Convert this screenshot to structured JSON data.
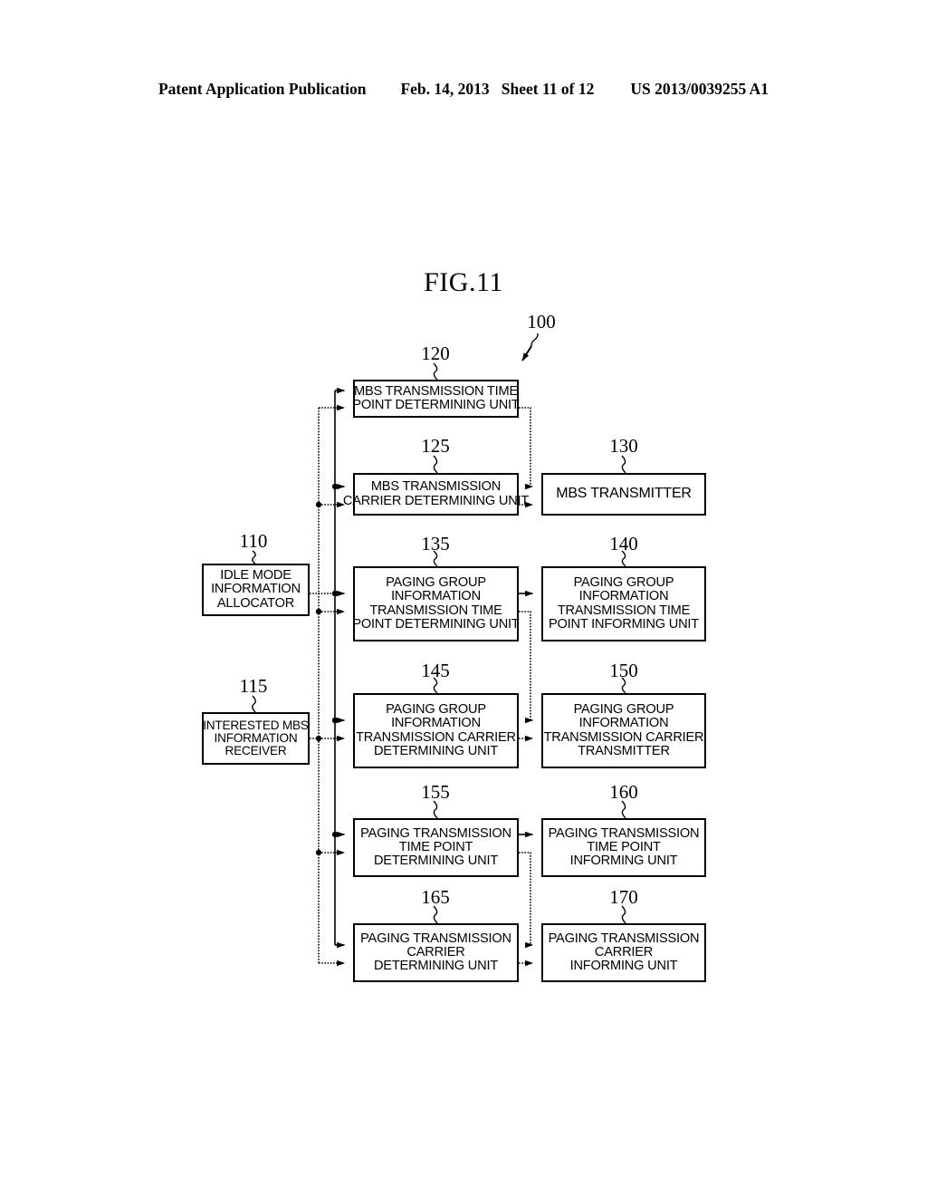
{
  "header": {
    "publication": "Patent Application Publication",
    "date": "Feb. 14, 2013",
    "sheet": "Sheet 11 of 12",
    "number": "US 2013/0039255 A1"
  },
  "figure": {
    "title": "FIG.11",
    "system_ref": "100"
  },
  "refs": {
    "r110": "110",
    "r115": "115",
    "r120": "120",
    "r125": "125",
    "r130": "130",
    "r135": "135",
    "r140": "140",
    "r145": "145",
    "r150": "150",
    "r155": "155",
    "r160": "160",
    "r165": "165",
    "r170": "170"
  },
  "boxes": {
    "b110": [
      "IDLE MODE",
      "INFORMATION",
      "ALLOCATOR"
    ],
    "b115": [
      "INTERESTED MBS",
      "INFORMATION",
      "RECEIVER"
    ],
    "b120": [
      "MBS TRANSMISSION TIME",
      "POINT DETERMINING UNIT"
    ],
    "b125": [
      "MBS TRANSMISSION",
      "CARRIER DETERMINING UNIT"
    ],
    "b130": [
      "MBS TRANSMITTER"
    ],
    "b135": [
      "PAGING GROUP",
      "INFORMATION",
      "TRANSMISSION TIME",
      "POINT DETERMINING UNIT"
    ],
    "b140": [
      "PAGING GROUP",
      "INFORMATION",
      "TRANSMISSION TIME",
      "POINT INFORMING UNIT"
    ],
    "b145": [
      "PAGING GROUP",
      "INFORMATION",
      "TRANSMISSION CARRIER",
      "DETERMINING UNIT"
    ],
    "b150": [
      "PAGING GROUP",
      "INFORMATION",
      "TRANSMISSION CARRIER",
      "TRANSMITTER"
    ],
    "b155": [
      "PAGING TRANSMISSION",
      "TIME POINT",
      "DETERMINING UNIT"
    ],
    "b160": [
      "PAGING TRANSMISSION",
      "TIME POINT",
      "INFORMING UNIT"
    ],
    "b165": [
      "PAGING TRANSMISSION",
      "CARRIER",
      "DETERMINING UNIT"
    ],
    "b170": [
      "PAGING TRANSMISSION",
      "CARRIER",
      "INFORMING UNIT"
    ]
  },
  "colors": {
    "ink": "#000000",
    "paper": "#ffffff"
  }
}
